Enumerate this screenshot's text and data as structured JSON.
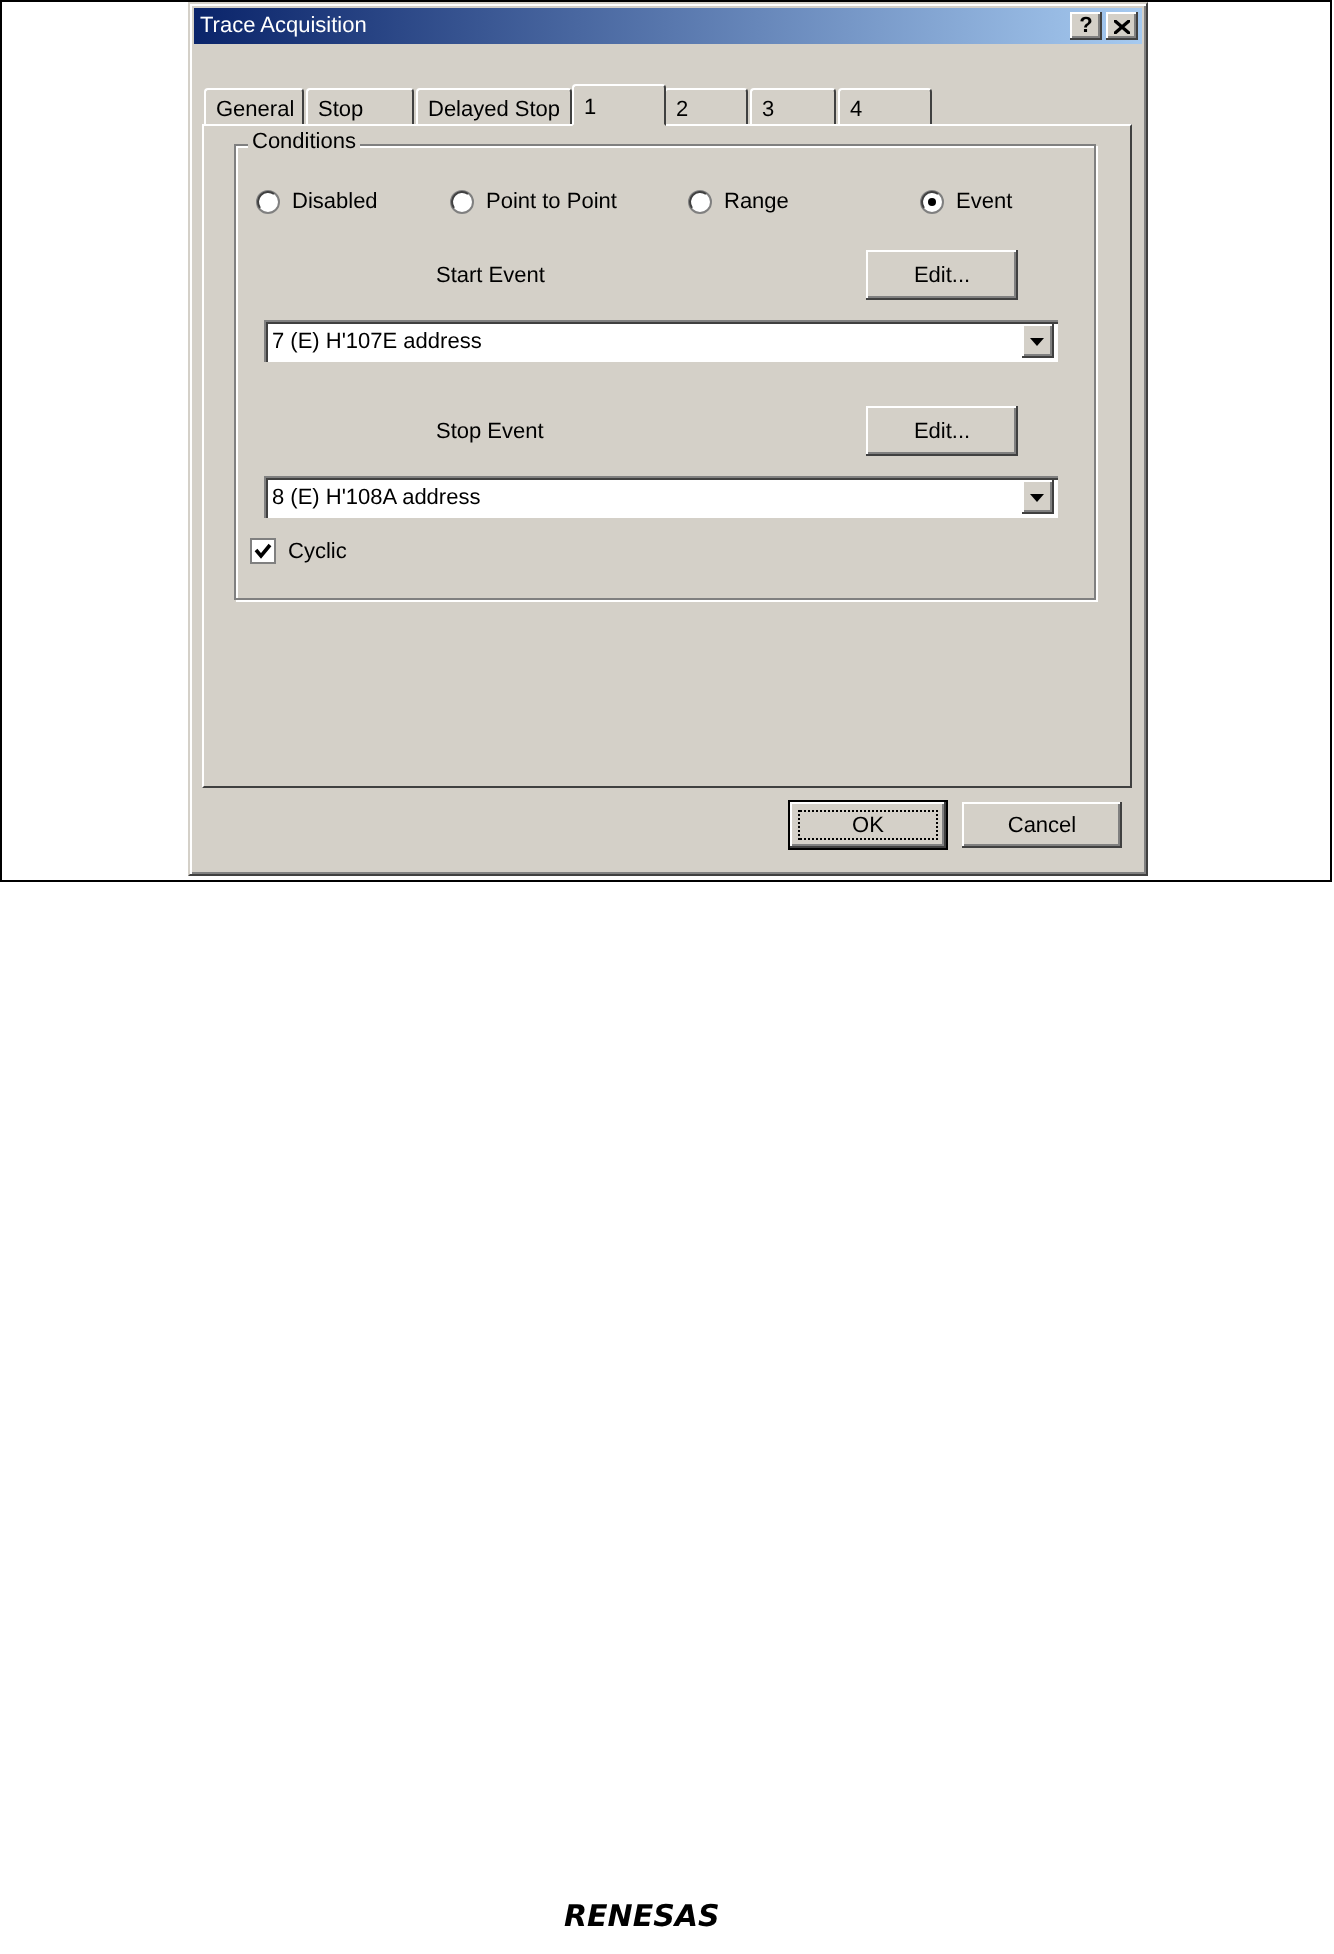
{
  "window": {
    "title": "Trace Acquisition",
    "help": "?"
  },
  "tabs": [
    {
      "label": "General",
      "selected": false
    },
    {
      "label": "Stop",
      "selected": false
    },
    {
      "label": "Delayed Stop",
      "selected": false
    },
    {
      "label": "1",
      "selected": true
    },
    {
      "label": "2",
      "selected": false
    },
    {
      "label": "3",
      "selected": false
    },
    {
      "label": "4",
      "selected": false
    }
  ],
  "conditions": {
    "title": "Conditions",
    "options": [
      {
        "label": "Disabled",
        "selected": false
      },
      {
        "label": "Point to Point",
        "selected": false
      },
      {
        "label": "Range",
        "selected": false
      },
      {
        "label": "Event",
        "selected": true
      }
    ],
    "events": [
      {
        "label": "Start Event",
        "edit": "Edit...",
        "value": "7 (E) H'107E address"
      },
      {
        "label": "Stop Event",
        "edit": "Edit...",
        "value": "8 (E) H'108A address"
      }
    ],
    "cyclic": {
      "label": "Cyclic",
      "checked": true
    }
  },
  "buttons": [
    {
      "label": "OK",
      "default": true
    },
    {
      "label": "Cancel",
      "default": false
    }
  ],
  "footer": {
    "logo": "RENESAS"
  }
}
